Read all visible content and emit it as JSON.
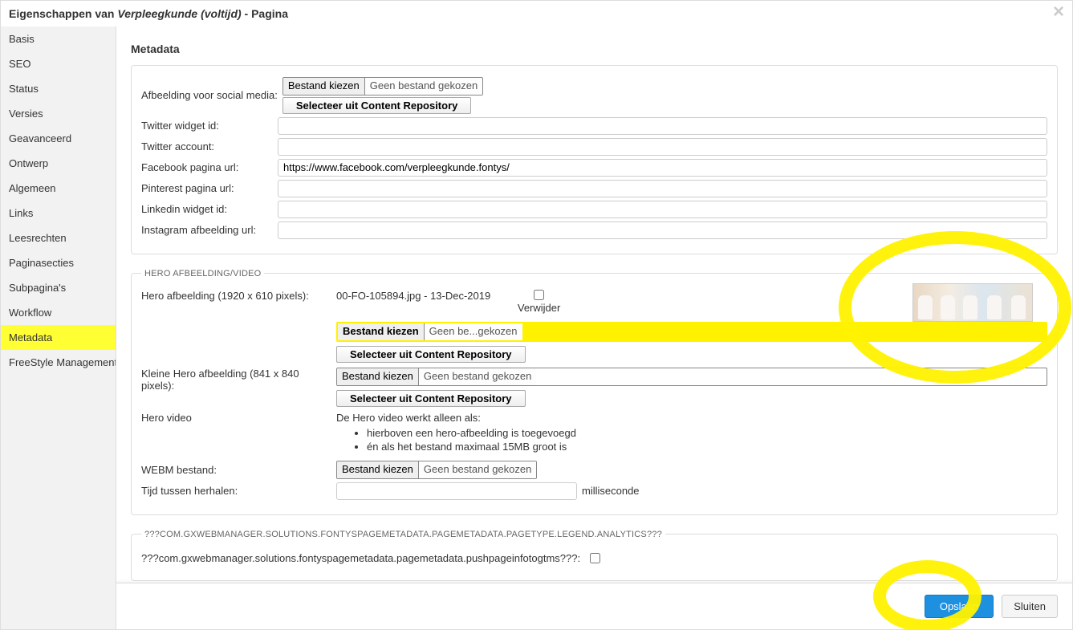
{
  "header": {
    "prefix": "Eigenschappen van ",
    "title_italic": "Verpleegkunde (voltijd)",
    "suffix": " - Pagina"
  },
  "sidebar": {
    "tabs": [
      "Basis",
      "SEO",
      "Status",
      "Versies",
      "Geavanceerd",
      "Ontwerp",
      "Algemeen",
      "Links",
      "Leesrechten",
      "Paginasecties",
      "Subpagina's",
      "Workflow",
      "Metadata",
      "FreeStyle Management"
    ],
    "active_index": 12
  },
  "content": {
    "title": "Metadata",
    "social": {
      "afbeelding_label": "Afbeelding voor social media:",
      "bestand_kiezen": "Bestand kiezen",
      "geen_bestand": "Geen bestand gekozen",
      "selecteer_repo": "Selecteer uit Content Repository",
      "twitter_widget_label": "Twitter widget id:",
      "twitter_widget_value": "",
      "twitter_account_label": "Twitter account:",
      "twitter_account_value": "",
      "facebook_label": "Facebook pagina url:",
      "facebook_value": "https://www.facebook.com/verpleegkunde.fontys/",
      "pinterest_label": "Pinterest pagina url:",
      "pinterest_value": "",
      "linkedin_label": "Linkedin widget id:",
      "linkedin_value": "",
      "instagram_label": "Instagram afbeelding url:",
      "instagram_value": ""
    },
    "hero": {
      "legend": "HERO AFBEELDING/VIDEO",
      "hero_afbeelding_label": "Hero afbeelding (1920 x 610 pixels):",
      "hero_afbeelding_file": "00-FO-105894.jpg - 13-Dec-2019",
      "verwijder_label": "Verwijder",
      "bestand_kiezen": "Bestand kiezen",
      "geen_be_gekozen": "Geen be...gekozen",
      "selecteer_repo": "Selecteer uit Content Repository",
      "kleine_hero_label": "Kleine Hero afbeelding (841 x 840 pixels):",
      "geen_bestand": "Geen bestand gekozen",
      "hero_video_label": "Hero video",
      "hero_video_note": "De Hero video werkt alleen als:",
      "hero_video_li1": "hierboven een hero-afbeelding is toegevoegd",
      "hero_video_li2": "én als het bestand maximaal 15MB groot is",
      "webm_label": "WEBM bestand:",
      "tijd_label": "Tijd tussen herhalen:",
      "tijd_value": "",
      "tijd_unit": "milliseconde"
    },
    "analytics": {
      "legend": "???COM.GXWEBMANAGER.SOLUTIONS.FONTYSPAGEMETADATA.PAGEMETADATA.PAGETYPE.LEGEND.ANALYTICS???",
      "push_label": "???com.gxwebmanager.solutions.fontyspagemetadata.pagemetadata.pushpageinfotogtms???:"
    }
  },
  "footer": {
    "save": "Opslaan",
    "close": "Sluiten"
  }
}
